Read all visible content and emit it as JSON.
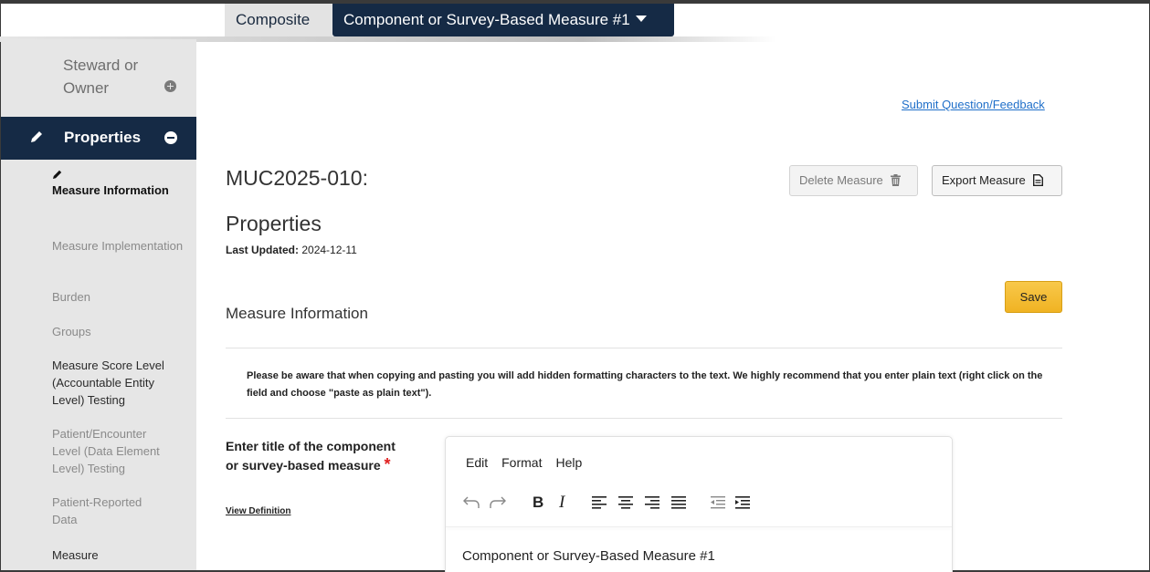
{
  "tabs": [
    {
      "label": "Composite"
    },
    {
      "label": "Component or Survey-Based Measure #1"
    }
  ],
  "sidebar": {
    "steward_label": "Steward or Owner",
    "properties_label": "Properties",
    "items": [
      {
        "label": "Measure Information"
      },
      {
        "label": "Measure Implementation"
      },
      {
        "label": "Burden"
      },
      {
        "label": "Groups"
      },
      {
        "label": "Measure Score Level (Accountable Entity Level) Testing"
      },
      {
        "label": "Patient/Encounter Level (Data Element Level) Testing"
      },
      {
        "label": "Patient-Reported Data"
      },
      {
        "label": "Measure"
      }
    ]
  },
  "header": {
    "feedback_link": "Submit Question/Feedback",
    "title": "MUC2025-010:",
    "subtitle": "Properties",
    "last_updated_label": "Last Updated:",
    "last_updated_value": "2024-12-11",
    "delete_button": "Delete Measure",
    "export_button": "Export Measure"
  },
  "section": {
    "title": "Measure Information",
    "save_button": "Save",
    "notice": "Please be aware that when copying and pasting you will add hidden formatting characters to the text. We highly recommend that you enter plain text (right click on the field and choose \"paste as plain text\")."
  },
  "field": {
    "label": "Enter title of the component or survey-based measure",
    "required_mark": "*",
    "view_definition": "View Definition"
  },
  "editor": {
    "menu": [
      "Edit",
      "Format",
      "Help"
    ],
    "toolbar_icons": [
      "undo-icon",
      "redo-icon",
      "bold-icon",
      "italic-icon",
      "align-left-icon",
      "align-center-icon",
      "align-right-icon",
      "align-justify-icon",
      "outdent-icon",
      "indent-icon"
    ],
    "content": "Component or Survey-Based Measure #1"
  },
  "colors": {
    "navy": "#152a45",
    "save": "#f0b323",
    "link": "#1f6fc9",
    "required": "#e02020"
  }
}
